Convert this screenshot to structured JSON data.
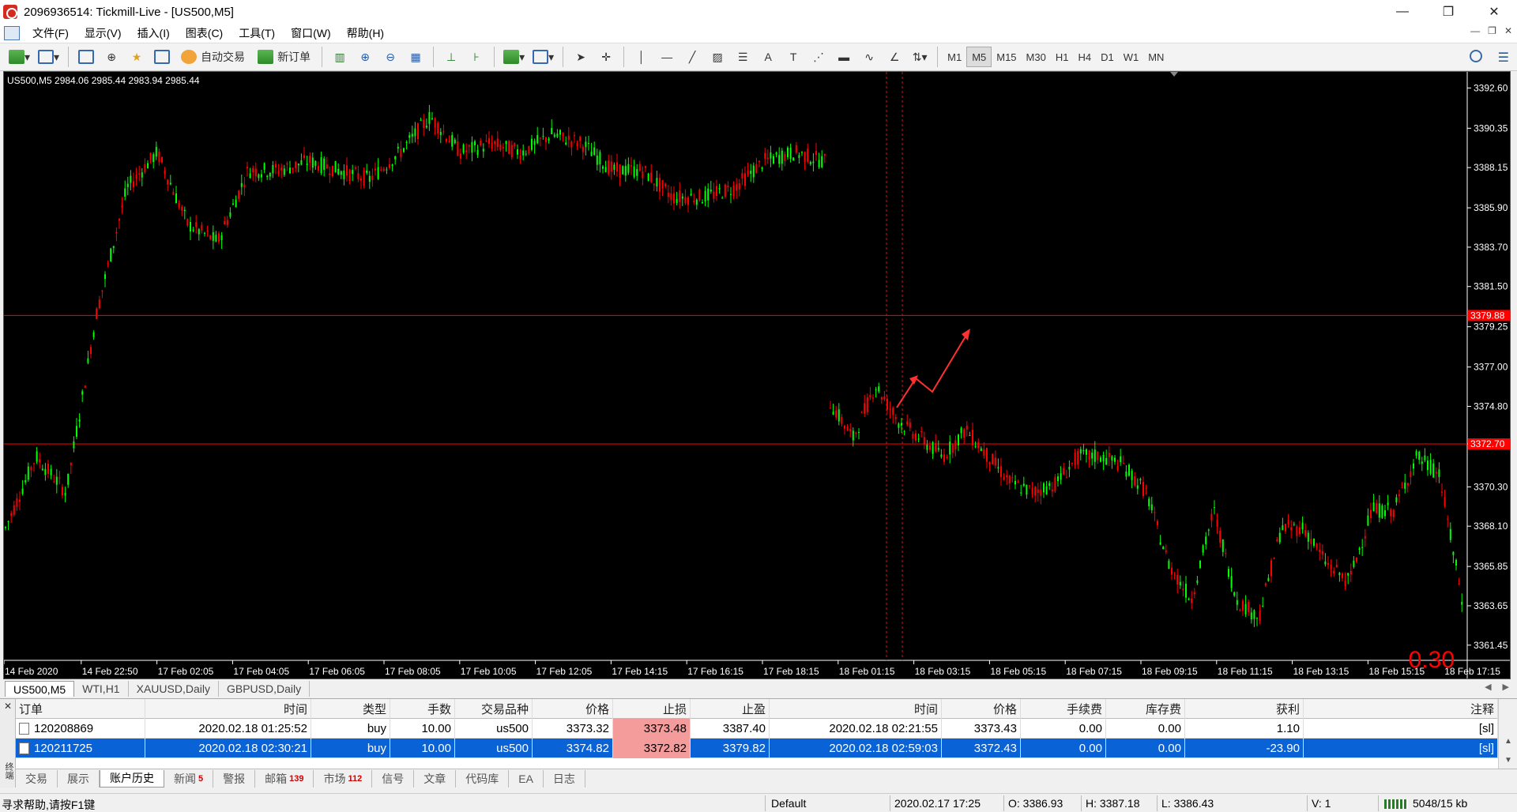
{
  "window": {
    "title": "2096936514: Tickmill-Live - [US500,M5]",
    "controls": [
      "—",
      "❐",
      "✕"
    ]
  },
  "menu": {
    "items": [
      "文件(F)",
      "显示(V)",
      "插入(I)",
      "图表(C)",
      "工具(T)",
      "窗口(W)",
      "帮助(H)"
    ]
  },
  "toolbar": {
    "auto_trade_label": "自动交易",
    "new_order_label": "新订单",
    "timeframes": [
      "M1",
      "M5",
      "M15",
      "M30",
      "H1",
      "H4",
      "D1",
      "W1",
      "MN"
    ],
    "active_timeframe": "M5"
  },
  "chart": {
    "info": "US500,M5  2984.06 2985.44 2983.94 2985.44",
    "spread": "0.30",
    "price_labels": [
      "3392.60",
      "3390.35",
      "3388.15",
      "3385.90",
      "3383.70",
      "3381.50",
      "3379.25",
      "3377.00",
      "3374.80",
      "3372.70",
      "3370.30",
      "3368.10",
      "3365.85",
      "3363.65",
      "3361.45"
    ],
    "tp_line_label": "3379.88",
    "sl_line_label": "3372.70",
    "time_labels": [
      "14 Feb 2020",
      "14 Feb 22:50",
      "17 Feb 02:05",
      "17 Feb 04:05",
      "17 Feb 06:05",
      "17 Feb 08:05",
      "17 Feb 10:05",
      "17 Feb 12:05",
      "17 Feb 14:15",
      "17 Feb 16:15",
      "17 Feb 18:15",
      "18 Feb 01:15",
      "18 Feb 03:15",
      "18 Feb 05:15",
      "18 Feb 07:15",
      "18 Feb 09:15",
      "18 Feb 11:15",
      "18 Feb 13:15",
      "18 Feb 15:15",
      "18 Feb 17:15"
    ],
    "colors": {
      "bull": "#00ff00",
      "bear": "#ff0000",
      "background": "#000000",
      "hline": "#ff0000"
    }
  },
  "chart_tabs": [
    "US500,M5",
    "WTI,H1",
    "XAUUSD,Daily",
    "GBPUSD,Daily"
  ],
  "terminal": {
    "columns": [
      "订单",
      "时间",
      "类型",
      "手数",
      "交易品种",
      "价格",
      "止损",
      "止盈",
      "时间",
      "价格",
      "手续费",
      "库存费",
      "获利",
      "注释"
    ],
    "rows": [
      [
        "120208869",
        "2020.02.18 01:25:52",
        "buy",
        "10.00",
        "us500",
        "3373.32",
        "3373.48",
        "3387.40",
        "2020.02.18 02:21:55",
        "3373.43",
        "0.00",
        "0.00",
        "1.10",
        "[sl]"
      ],
      [
        "120211725",
        "2020.02.18 02:30:21",
        "buy",
        "10.00",
        "us500",
        "3374.82",
        "3372.82",
        "3379.82",
        "2020.02.18 02:59:03",
        "3372.43",
        "0.00",
        "0.00",
        "-23.90",
        "[sl]"
      ]
    ],
    "side_label": "终端",
    "tabs": [
      {
        "label": "交易",
        "badge": ""
      },
      {
        "label": "展示",
        "badge": ""
      },
      {
        "label": "账户历史",
        "badge": ""
      },
      {
        "label": "新闻",
        "badge": "5"
      },
      {
        "label": "警报",
        "badge": ""
      },
      {
        "label": "邮箱",
        "badge": "139"
      },
      {
        "label": "市场",
        "badge": "112"
      },
      {
        "label": "信号",
        "badge": ""
      },
      {
        "label": "文章",
        "badge": ""
      },
      {
        "label": "代码库",
        "badge": ""
      },
      {
        "label": "EA",
        "badge": ""
      },
      {
        "label": "日志",
        "badge": ""
      }
    ]
  },
  "status": {
    "help": "寻求帮助,请按F1键",
    "profile": "Default",
    "datetime": "2020.02.17 17:25",
    "open": "O: 3386.93",
    "high": "H: 3387.18",
    "low": "L: 3386.43",
    "volume": "V: 1",
    "traffic": "5048/15 kb"
  }
}
